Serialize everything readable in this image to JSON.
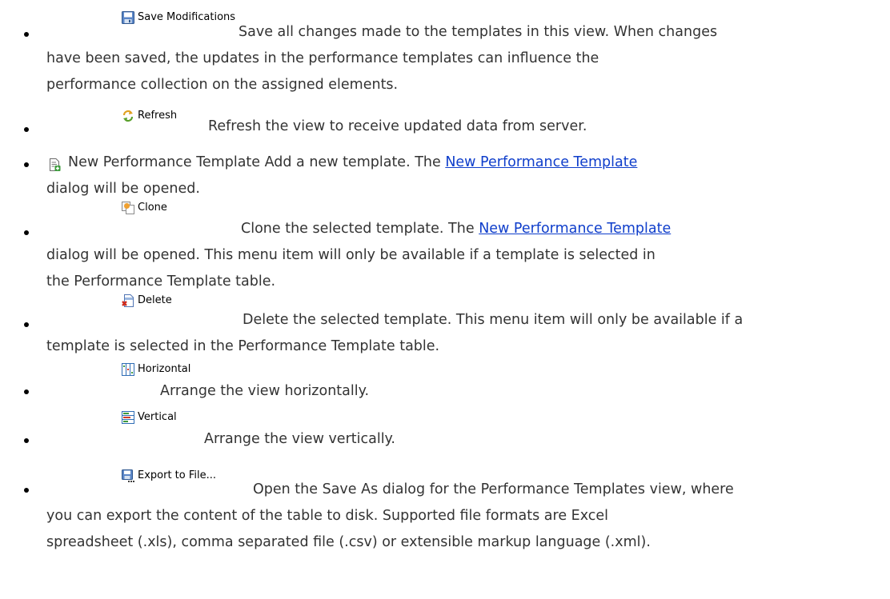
{
  "items": [
    {
      "button": {
        "label": "Save Modifications",
        "icon": "save-icon"
      },
      "lines": [
        "Save all changes made to the templates in this view. When changes",
        "have been saved, the updates in the performance templates can influence the",
        "performance collection on the assigned elements."
      ]
    },
    {
      "button": {
        "label": "Refresh",
        "icon": "refresh-icon"
      },
      "lines": [
        "Refresh the view to receive updated data from server."
      ]
    },
    {
      "button": {
        "label": "",
        "icon": "new-template-icon"
      },
      "line1_before": "New Performance Template Add a new template. The",
      "link": "New Performance Template",
      "line2": "dialog will be opened."
    },
    {
      "button": {
        "label": "Clone",
        "icon": "clone-icon"
      },
      "line1_before": "Clone the selected template. The",
      "link": "New Performance Template",
      "lines_after": [
        "dialog will be opened. This menu item will only be available if a template is selected in",
        "the Performance Template table."
      ]
    },
    {
      "button": {
        "label": "Delete",
        "icon": "delete-icon"
      },
      "lines": [
        "Delete the selected template. This menu item will only be available if a",
        "template is selected in the Performance Template table."
      ]
    },
    {
      "button": {
        "label": "Horizontal",
        "icon": "horizontal-layout-icon"
      },
      "lines": [
        "Arrange the view horizontally."
      ]
    },
    {
      "button": {
        "label": "Vertical",
        "icon": "vertical-layout-icon"
      },
      "lines": [
        "Arrange the view vertically."
      ]
    },
    {
      "button": {
        "label": "Export to File...",
        "icon": "export-icon"
      },
      "lines": [
        "Open the Save As dialog for the Performance Templates view, where",
        "you can export the content of the table to disk. Supported file formats are Excel",
        "spreadsheet (.xls), comma separated file (.csv) or extensible markup language (.xml)."
      ]
    }
  ],
  "colors": {
    "text": "#333333",
    "link": "#0f3ecb",
    "bullet": "#000000"
  }
}
